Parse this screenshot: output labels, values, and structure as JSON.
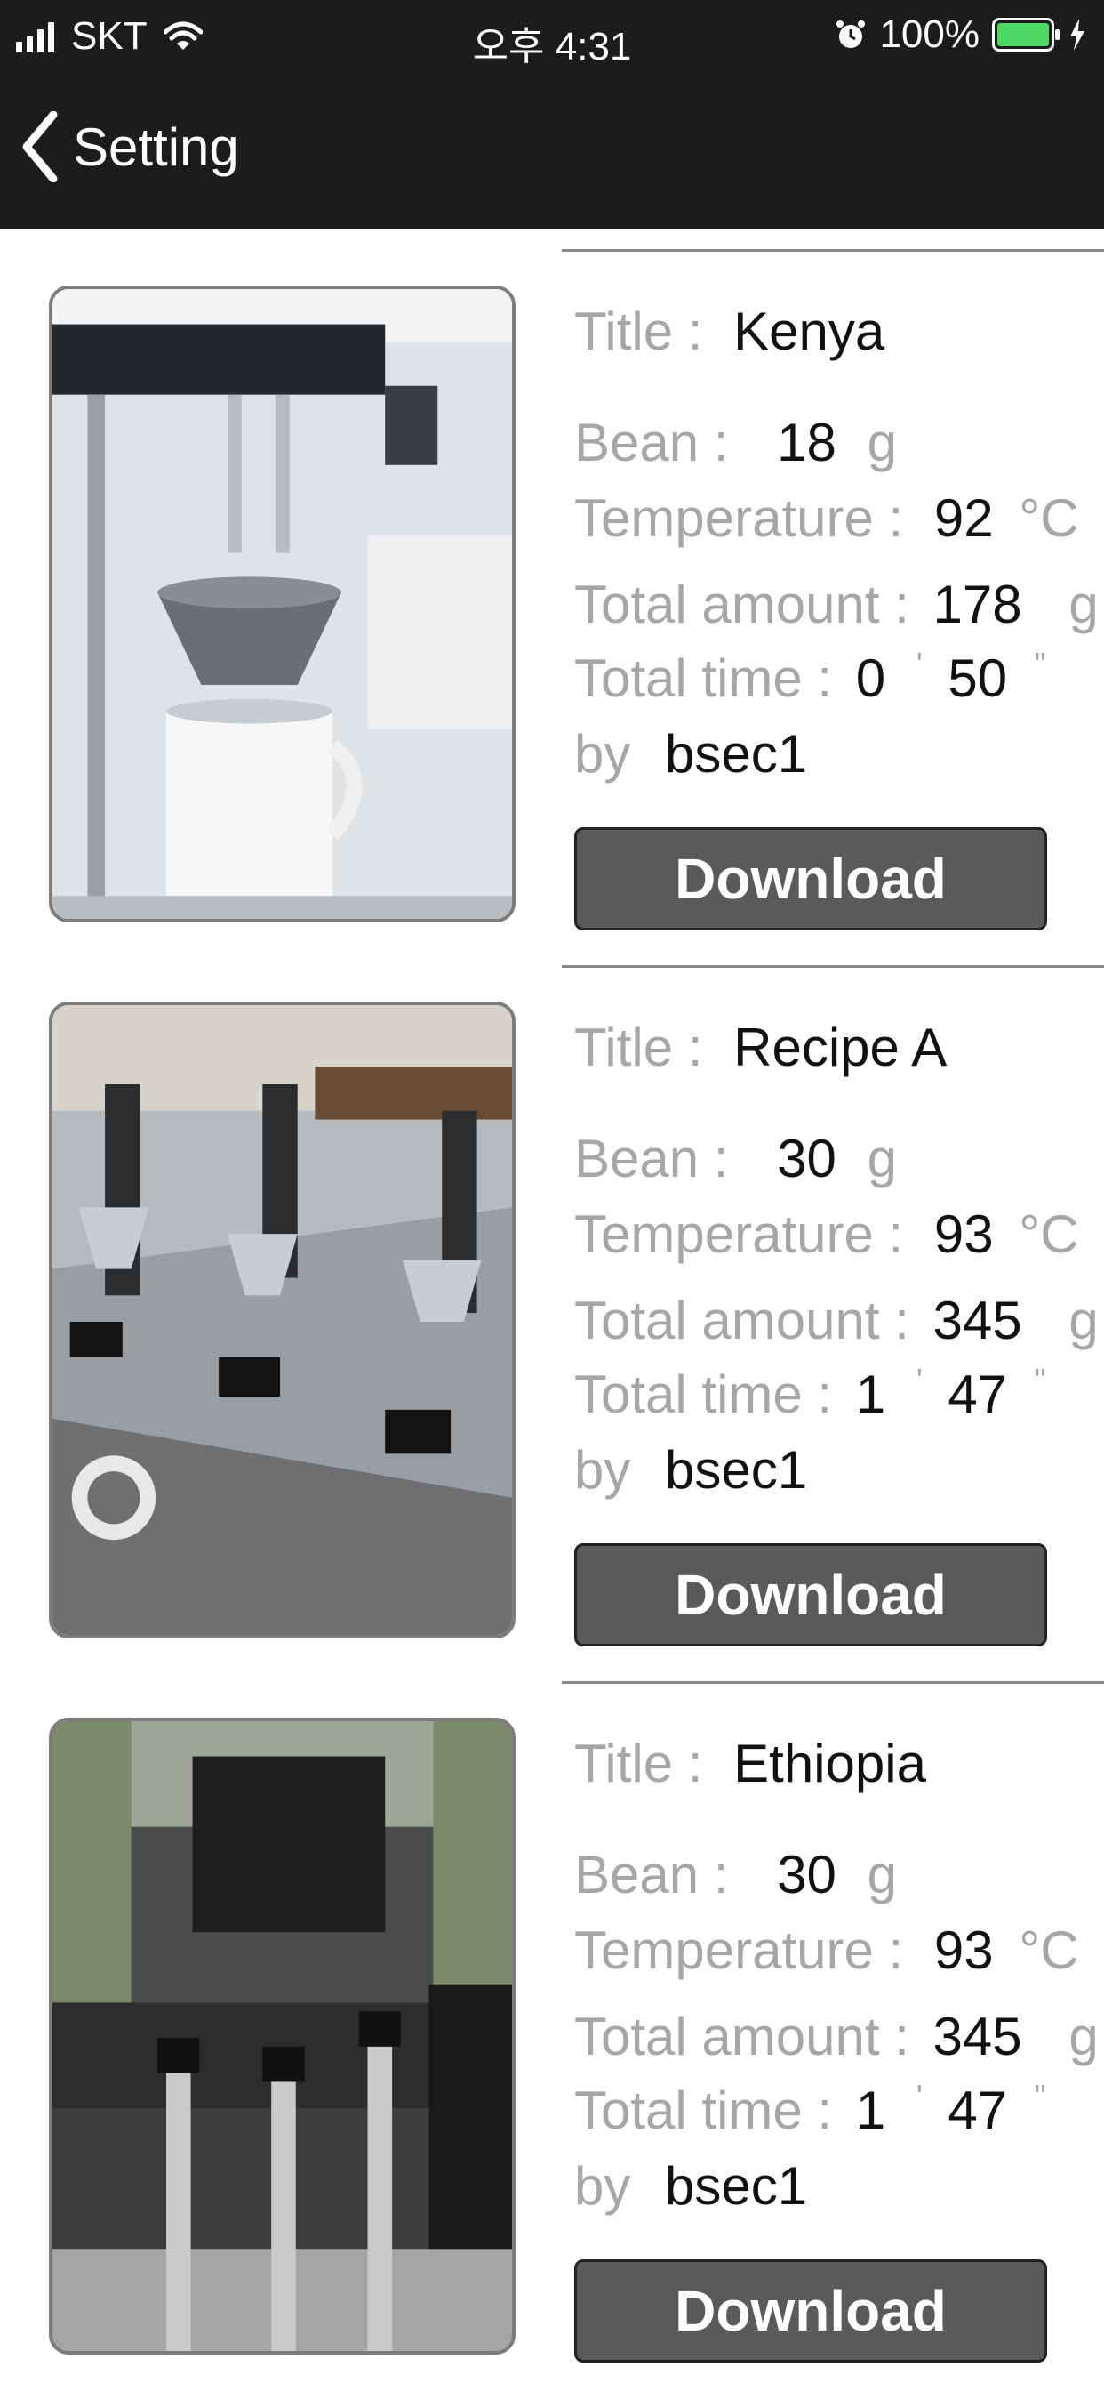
{
  "status_bar": {
    "carrier": "SKT",
    "time": "오후 4:31",
    "battery": "100%"
  },
  "nav": {
    "back_label": "Setting"
  },
  "labels": {
    "title": "Title :",
    "bean": "Bean :",
    "temperature": "Temperature :",
    "total_amount": "Total amount :",
    "total_time": "Total time :",
    "by": "by",
    "download": "Download",
    "unit_g": "g",
    "unit_c": "°C",
    "minute_mark": "'",
    "second_mark": "\""
  },
  "recipes": [
    {
      "title": "Kenya",
      "bean": "18",
      "temperature": "92",
      "total_amount": "178",
      "minutes": "0",
      "seconds": "50",
      "author": "bsec1"
    },
    {
      "title": "Recipe A",
      "bean": "30",
      "temperature": "93",
      "total_amount": "345",
      "minutes": "1",
      "seconds": "47",
      "author": "bsec1"
    },
    {
      "title": "Ethiopia",
      "bean": "30",
      "temperature": "93",
      "total_amount": "345",
      "minutes": "1",
      "seconds": "47",
      "author": "bsec1"
    }
  ]
}
